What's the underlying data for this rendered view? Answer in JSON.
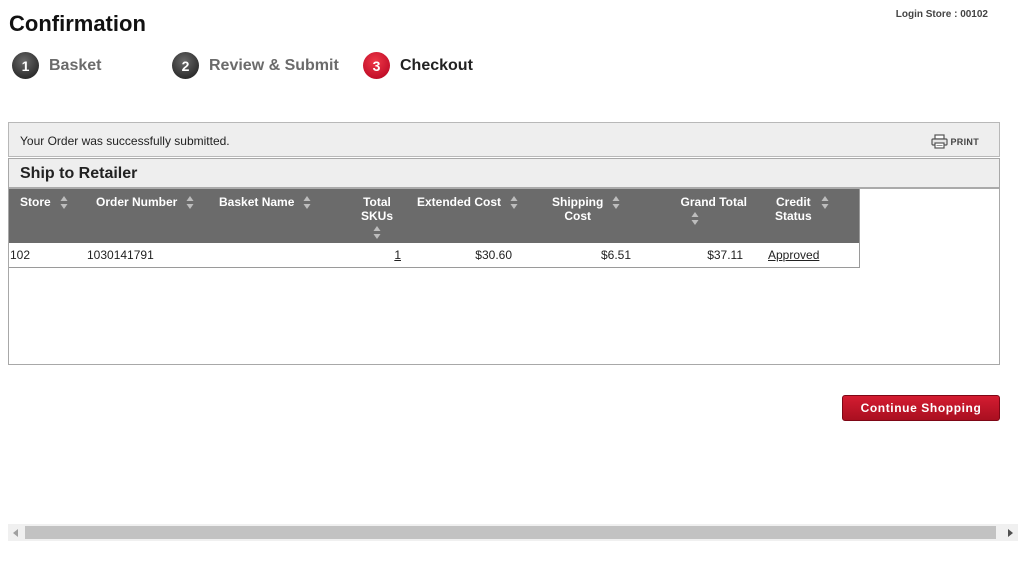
{
  "header": {
    "title": "Confirmation",
    "login_store": "Login Store : 00102"
  },
  "steps": [
    {
      "number": "1",
      "label": "Basket",
      "active": false
    },
    {
      "number": "2",
      "label": "Review & Submit",
      "active": false
    },
    {
      "number": "3",
      "label": "Checkout",
      "active": true
    }
  ],
  "status": {
    "message": "Your Order was successfully submitted.",
    "print_label": "PRINT",
    "print_icon": "printer-icon"
  },
  "panel": {
    "title": "Ship to Retailer"
  },
  "table": {
    "columns": [
      {
        "line1": "Store",
        "line2": ""
      },
      {
        "line1": "Order Number",
        "line2": ""
      },
      {
        "line1": "Basket Name",
        "line2": ""
      },
      {
        "line1": "Total",
        "line2": "SKUs"
      },
      {
        "line1": "Extended Cost",
        "line2": ""
      },
      {
        "line1": "Shipping",
        "line2": "Cost"
      },
      {
        "line1": "Grand Total",
        "line2": ""
      },
      {
        "line1": "Credit",
        "line2": "Status"
      }
    ],
    "rows": [
      {
        "store": "102",
        "order_number": "1030141791",
        "basket_name": "",
        "total_skus": "1",
        "extended_cost": "$30.60",
        "shipping_cost": "$6.51",
        "grand_total": "$37.11",
        "credit_status": "Approved"
      }
    ]
  },
  "actions": {
    "continue_label": "Continue Shopping"
  },
  "colors": {
    "brand_red": "#c4102a",
    "table_header": "#6b6b6b",
    "bar_background": "#eeeeee"
  }
}
